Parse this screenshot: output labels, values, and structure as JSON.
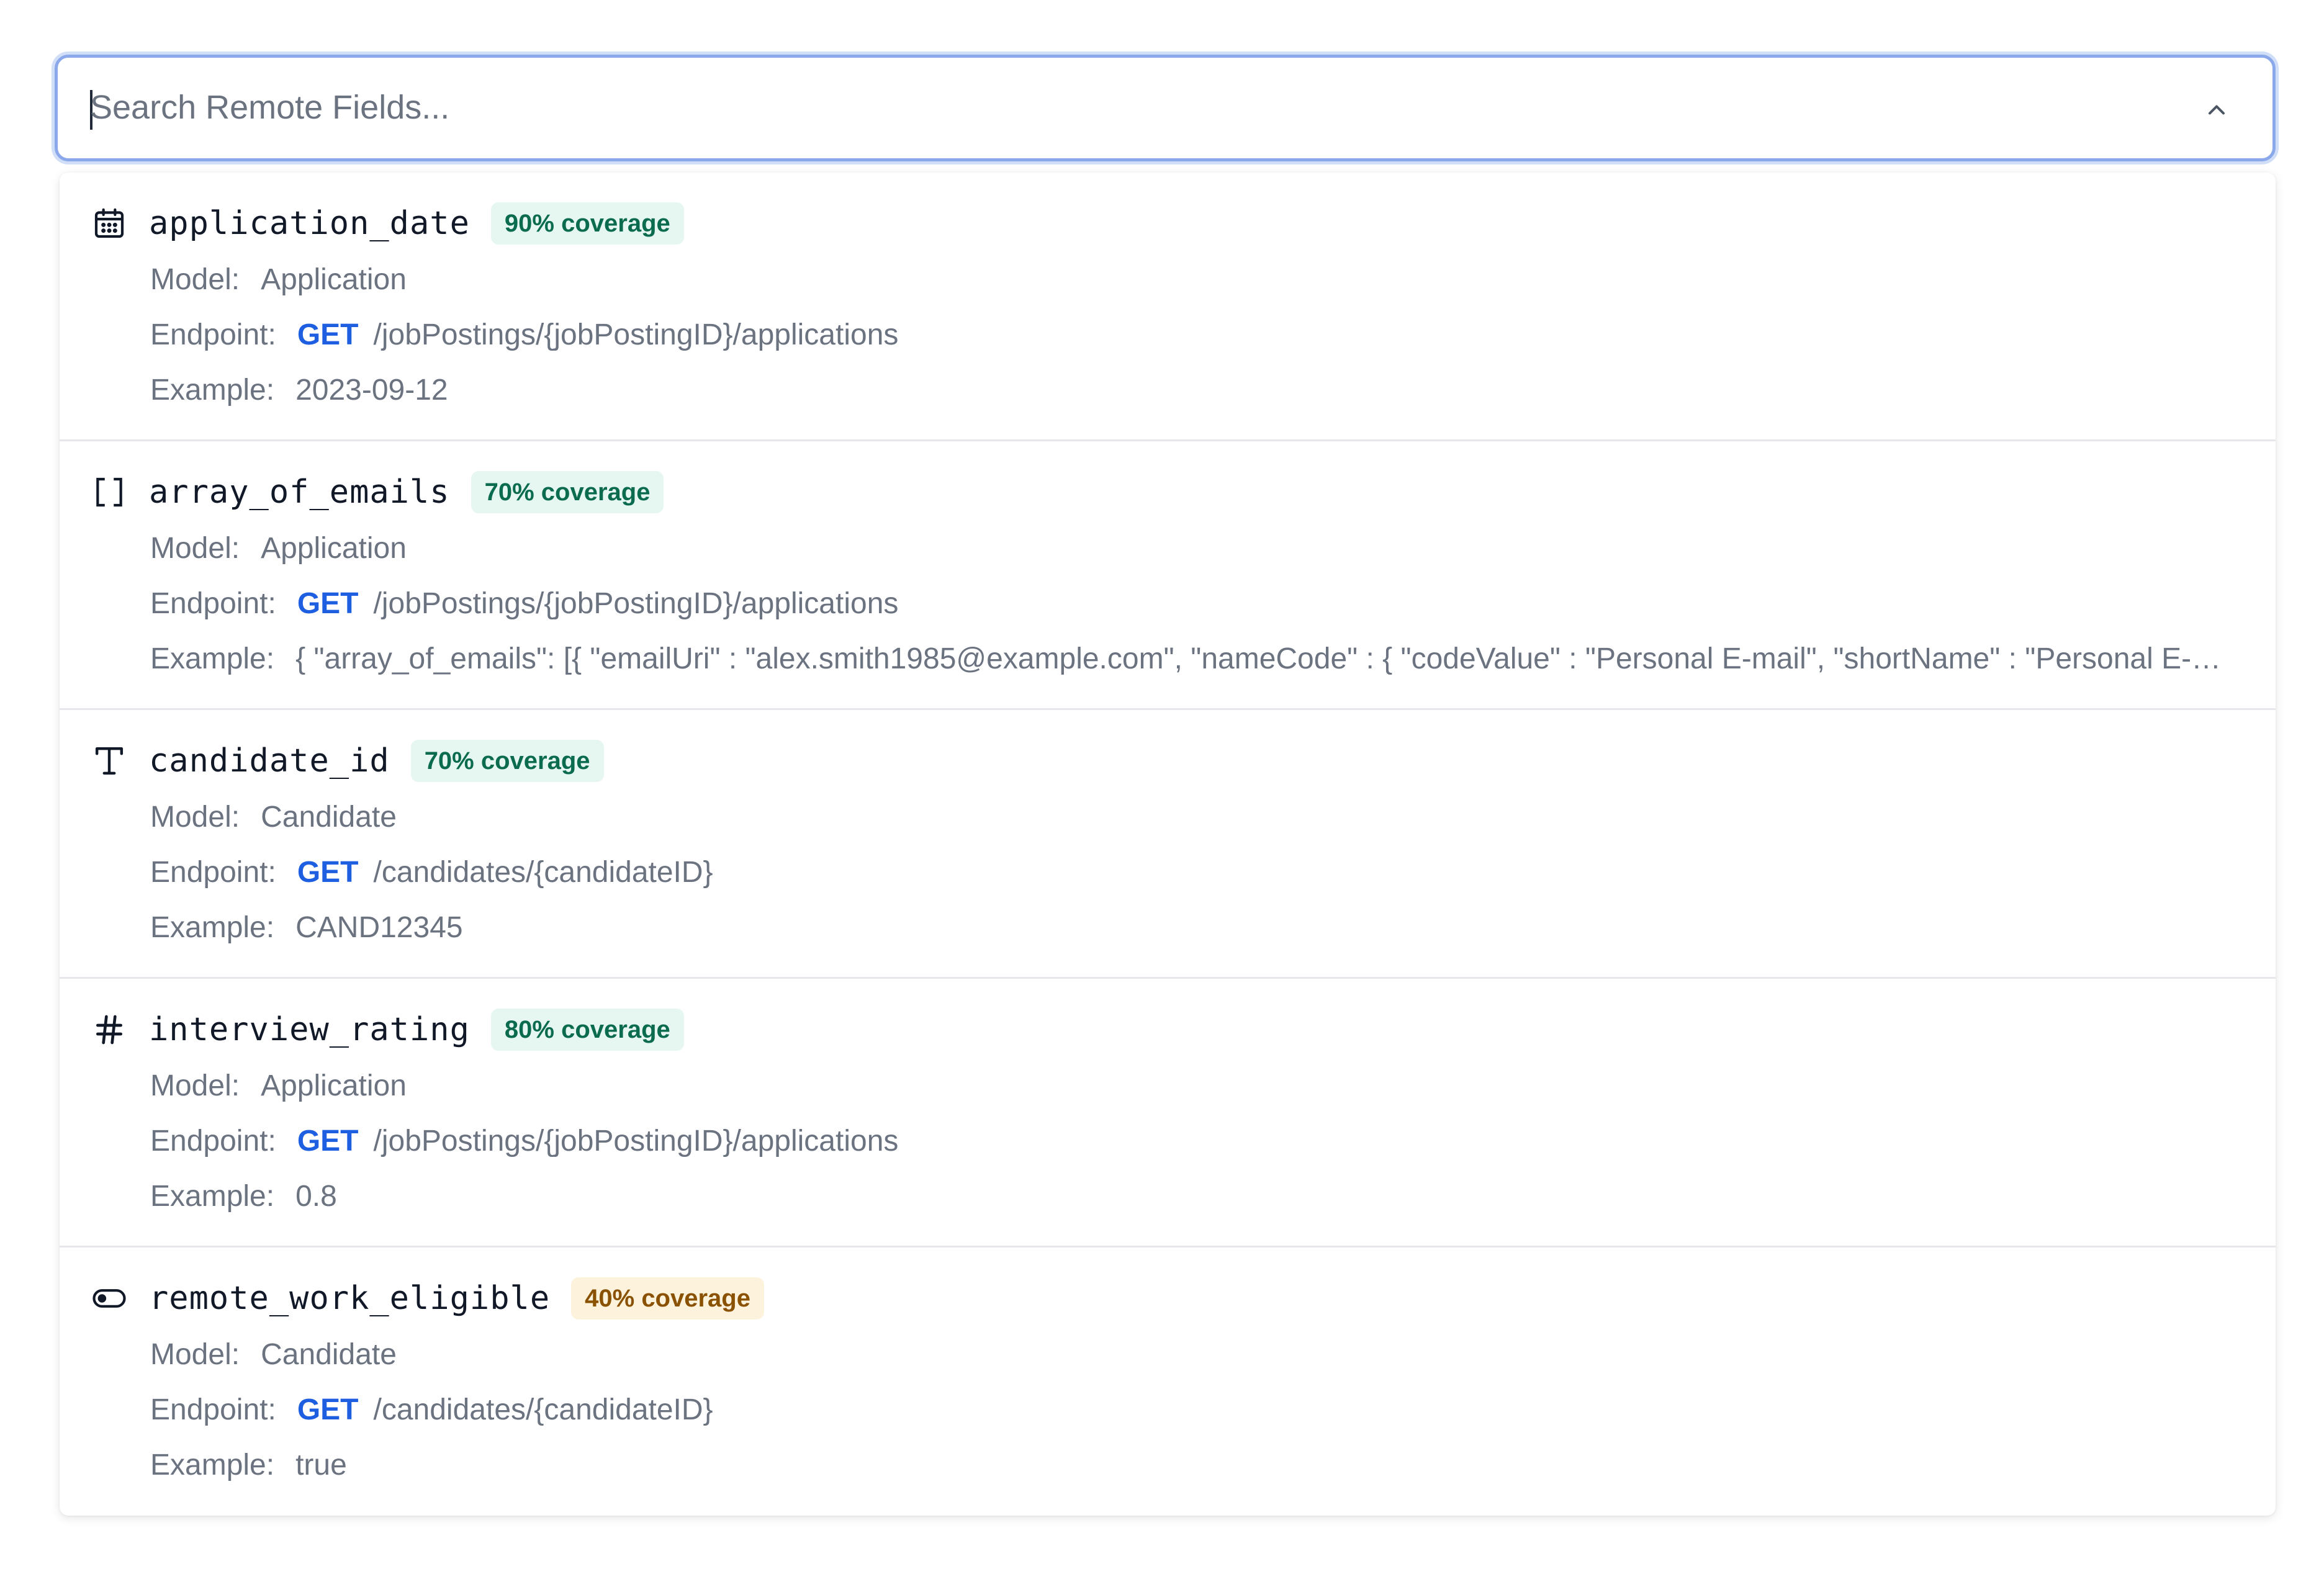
{
  "search": {
    "placeholder": "Search Remote Fields...",
    "value": ""
  },
  "labels": {
    "model": "Model:",
    "endpoint": "Endpoint:",
    "example": "Example:"
  },
  "colors": {
    "accent": "#1d5fe0",
    "focus_ring": "#8aa8ea",
    "badge_green_bg": "#e6f7f1",
    "badge_green_text": "#0b6b4e",
    "badge_amber_bg": "#fdf3dd",
    "badge_amber_text": "#8a5200"
  },
  "fields": [
    {
      "icon": "calendar-icon",
      "name": "application_date",
      "coverage": "90% coverage",
      "coverage_level": "green",
      "model": "Application",
      "method": "GET",
      "path": "/jobPostings/{jobPostingID}/applications",
      "example": "2023-09-12"
    },
    {
      "icon": "array-brackets-icon",
      "name": "array_of_emails",
      "coverage": "70% coverage",
      "coverage_level": "green",
      "model": "Application",
      "method": "GET",
      "path": "/jobPostings/{jobPostingID}/applications",
      "example": "{ \"array_of_emails\": [{ \"emailUri\" : \"alex.smith1985@example.com\", \"nameCode\" : { \"codeValue\" : \"Personal E-mail\", \"shortName\" : \"Personal E-mail\" } }] }"
    },
    {
      "icon": "text-type-icon",
      "name": "candidate_id",
      "coverage": "70% coverage",
      "coverage_level": "green",
      "model": "Candidate",
      "method": "GET",
      "path": "/candidates/{candidateID}",
      "example": "CAND12345"
    },
    {
      "icon": "hash-icon",
      "name": "interview_rating",
      "coverage": "80% coverage",
      "coverage_level": "green",
      "model": "Application",
      "method": "GET",
      "path": "/jobPostings/{jobPostingID}/applications",
      "example": "0.8"
    },
    {
      "icon": "toggle-icon",
      "name": "remote_work_eligible",
      "coverage": "40% coverage",
      "coverage_level": "amber",
      "model": "Candidate",
      "method": "GET",
      "path": "/candidates/{candidateID}",
      "example": "true"
    }
  ]
}
